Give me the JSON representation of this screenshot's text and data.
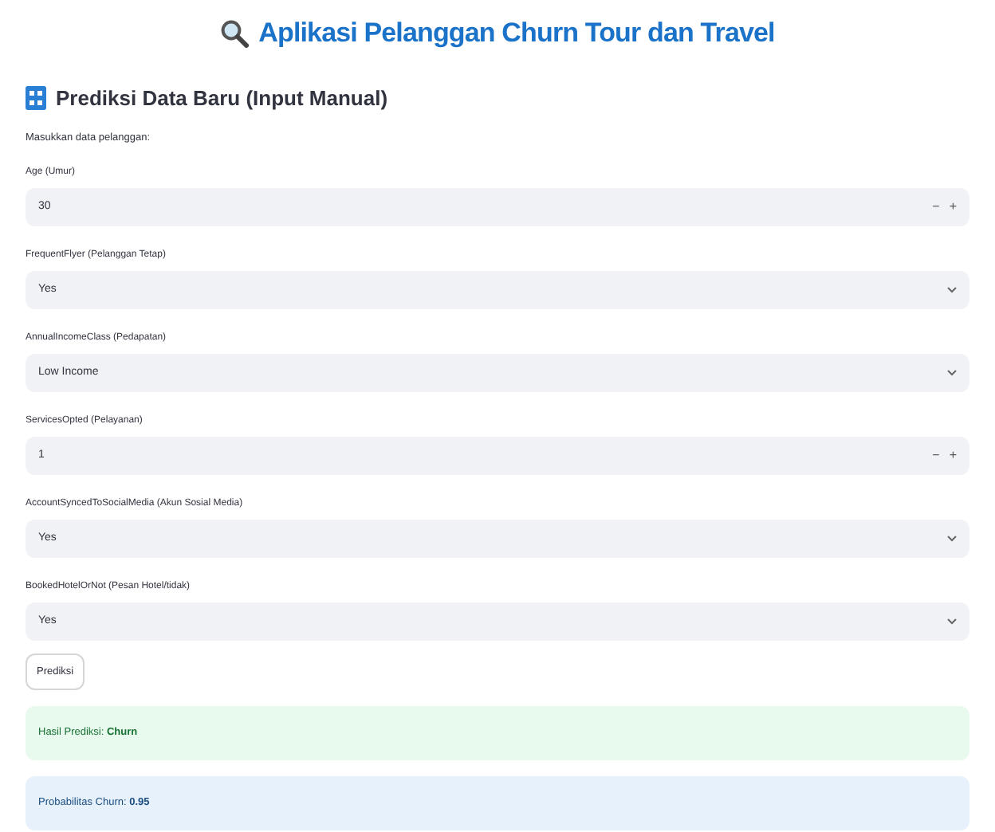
{
  "title": "Aplikasi Pelanggan Churn Tour dan Travel",
  "section_header": "Prediksi Data Baru (Input Manual)",
  "intro": "Masukkan data pelanggan:",
  "fields": [
    {
      "kind": "number",
      "label": "Age (Umur)",
      "value": "30",
      "decrement": "−",
      "increment": "+"
    },
    {
      "kind": "select",
      "label": "FrequentFlyer (Pelanggan Tetap)",
      "value": "Yes"
    },
    {
      "kind": "select",
      "label": "AnnualIncomeClass (Pedapatan)",
      "value": "Low Income"
    },
    {
      "kind": "number",
      "label": "ServicesOpted (Pelayanan)",
      "value": "1",
      "decrement": "−",
      "increment": "+"
    },
    {
      "kind": "select",
      "label": "AccountSyncedToSocialMedia (Akun Sosial Media)",
      "value": "Yes"
    },
    {
      "kind": "select",
      "label": "BookedHotelOrNot (Pesan Hotel/tidak)",
      "value": "Yes"
    }
  ],
  "button": "Prediksi",
  "results": [
    {
      "kind": "success",
      "text": "Hasil Prediksi: **Churn**"
    },
    {
      "kind": "info",
      "text": "Probabilitas Churn: **0.95**"
    }
  ]
}
